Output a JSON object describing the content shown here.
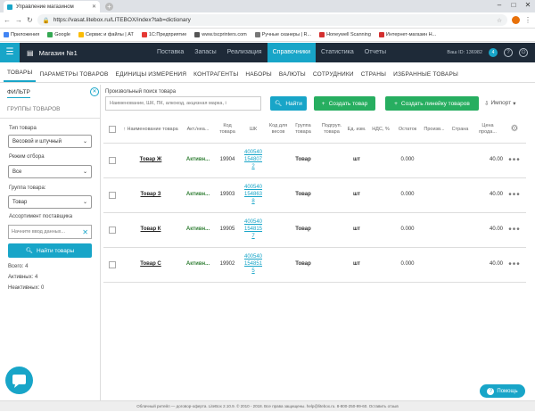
{
  "browser": {
    "tab_title": "Управление магазином",
    "url": "https://vasat.litebox.ru/LITEBOX/index?tab=dictionary",
    "bookmarks": [
      "Приложения",
      "Google",
      "Сервис и файлы | АТ",
      "1С:Предприятие",
      "www.tscprinters.com",
      "Ручные сканеры | R...",
      "Honeywell Scanning",
      "Интернет-магазин Н..."
    ]
  },
  "topnav": {
    "shop_name": "Магазин №1",
    "items": [
      "Поставка",
      "Запасы",
      "Реализация",
      "Справочники",
      "Статистика",
      "Отчеты"
    ],
    "active": "Справочники",
    "id_text": "Ваш ID: 136982",
    "notif_count": "4"
  },
  "subnav": {
    "tabs": [
      "ТОВАРЫ",
      "ПАРАМЕТРЫ ТОВАРОВ",
      "ЕДИНИЦЫ ИЗМЕРЕНИЯ",
      "КОНТРАГЕНТЫ",
      "НАБОРЫ",
      "ВАЛЮТЫ",
      "СОТРУДНИКИ",
      "СТРАНЫ",
      "ИЗБРАННЫЕ ТОВАРЫ"
    ],
    "active": "ТОВАРЫ"
  },
  "sidebar": {
    "filter_tab": "ФИЛЬТР",
    "groups_tab": "ГРУППЫ ТОВАРОВ",
    "type_label": "Тип товара",
    "type_value": "Весовой и штучный",
    "mode_label": "Режим отбора",
    "mode_value": "Все",
    "group_label": "Группа товара:",
    "group_value": "Товар",
    "assort_label": "Ассортимент поставщика",
    "assort_placeholder": "Начните ввод данных...",
    "find_button": "Найти товары",
    "total": "Всего: 4",
    "active": "Активных: 4",
    "inactive": "Неактивных: 0"
  },
  "search": {
    "label": "Произвольный поиск товара",
    "placeholder": "Наименование, ШК, ПК, алкокод, акцизная марка, і",
    "find_button": "Найти",
    "create_button": "Создать товар",
    "create_line_button": "Создать линейку товаров",
    "import_button": "Импорт"
  },
  "table": {
    "headers": [
      "Наименование товара",
      "Акт./неа...",
      "Код товара",
      "ШК",
      "Код для весов",
      "Группа товара",
      "Подгруп. товара",
      "Ед. изм.",
      "НДС, %",
      "Остаток",
      "Произв...",
      "Страна",
      "Цена прода..."
    ],
    "rows": [
      {
        "name": "Товар Ж",
        "status": "Активн...",
        "code": "19904",
        "barcode": [
          "400540",
          "154807",
          "2"
        ],
        "group": "Товар",
        "unit": "шт",
        "stock": "0.000",
        "price": "40.00"
      },
      {
        "name": "Товар З",
        "status": "Активн...",
        "code": "19903",
        "barcode": [
          "400540",
          "154863",
          "8"
        ],
        "group": "Товар",
        "unit": "шт",
        "stock": "0.000",
        "price": "40.00"
      },
      {
        "name": "Товар К",
        "status": "Активн...",
        "code": "19905",
        "barcode": [
          "400540",
          "154815",
          "7"
        ],
        "group": "Товар",
        "unit": "шт",
        "stock": "0.000",
        "price": "40.00"
      },
      {
        "name": "Товар С",
        "status": "Активн...",
        "code": "19902",
        "barcode": [
          "400540",
          "154851",
          "5"
        ],
        "group": "Товар",
        "unit": "шт",
        "stock": "0.000",
        "price": "40.00"
      }
    ]
  },
  "footer": {
    "text": "Облачный ритейл — договор-оферта. LiteBox 2.10.9. © 2010 - 2018. Все права защищены. help@litebox.ru. 8-800-250-99-60. Оставить отзыв"
  },
  "help_button": "Помощь",
  "colors": {
    "accent": "#18a5c8",
    "topnav_bg": "#1e2a38",
    "green": "#27ae60"
  }
}
